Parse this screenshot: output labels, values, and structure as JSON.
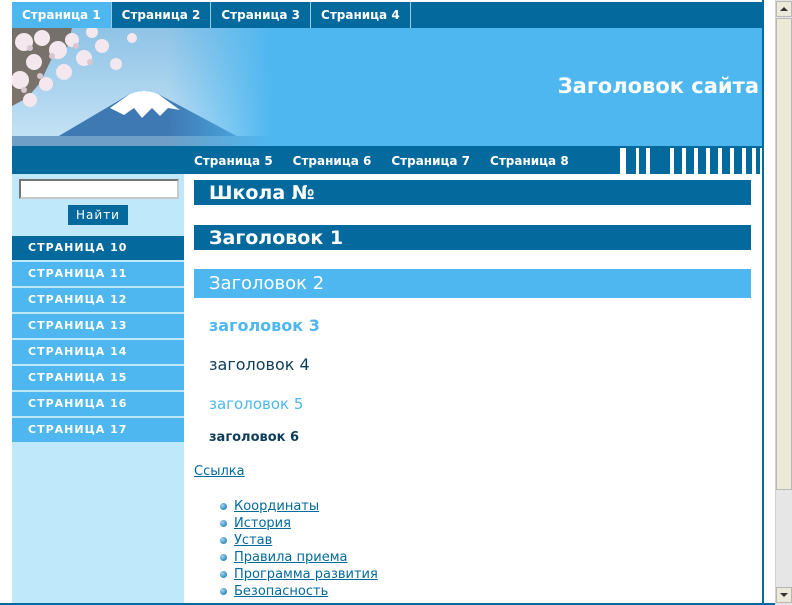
{
  "top_nav": {
    "tabs": [
      {
        "label": "Страница 1"
      },
      {
        "label": "Страница 2"
      },
      {
        "label": "Страница 3"
      },
      {
        "label": "Страница 4"
      }
    ]
  },
  "banner": {
    "site_title": "Заголовок сайта"
  },
  "sub_nav": {
    "links": [
      {
        "label": "Страница 5"
      },
      {
        "label": "Страница 6"
      },
      {
        "label": "Страница 7"
      },
      {
        "label": "Страница 8"
      }
    ]
  },
  "sidebar": {
    "search_value": "",
    "search_button": "Найти",
    "menu": [
      {
        "label": "СТРАНИЦА 10"
      },
      {
        "label": "СТРАНИЦА 11"
      },
      {
        "label": "СТРАНИЦА 12"
      },
      {
        "label": "СТРАНИЦА 13"
      },
      {
        "label": "СТРАНИЦА 14"
      },
      {
        "label": "СТРАНИЦА 15"
      },
      {
        "label": "СТРАНИЦА 16"
      },
      {
        "label": "СТРАНИЦА 17"
      }
    ]
  },
  "content": {
    "school_heading": "Школа №",
    "h1": "Заголовок 1",
    "h2": "Заголовок 2",
    "h3": "заголовок 3",
    "h4": "заголовок 4",
    "h5": "заголовок 5",
    "h6": "заголовок 6",
    "link": "Ссылка",
    "list": [
      {
        "label": "Координаты"
      },
      {
        "label": "История"
      },
      {
        "label": "Устав"
      },
      {
        "label": "Правила приема"
      },
      {
        "label": "Программа развития"
      },
      {
        "label": "Безопасность"
      }
    ]
  },
  "colors": {
    "dark_blue": "#04699c",
    "light_blue": "#4eb7f0",
    "sidebar_bg": "#bfe8fb"
  }
}
